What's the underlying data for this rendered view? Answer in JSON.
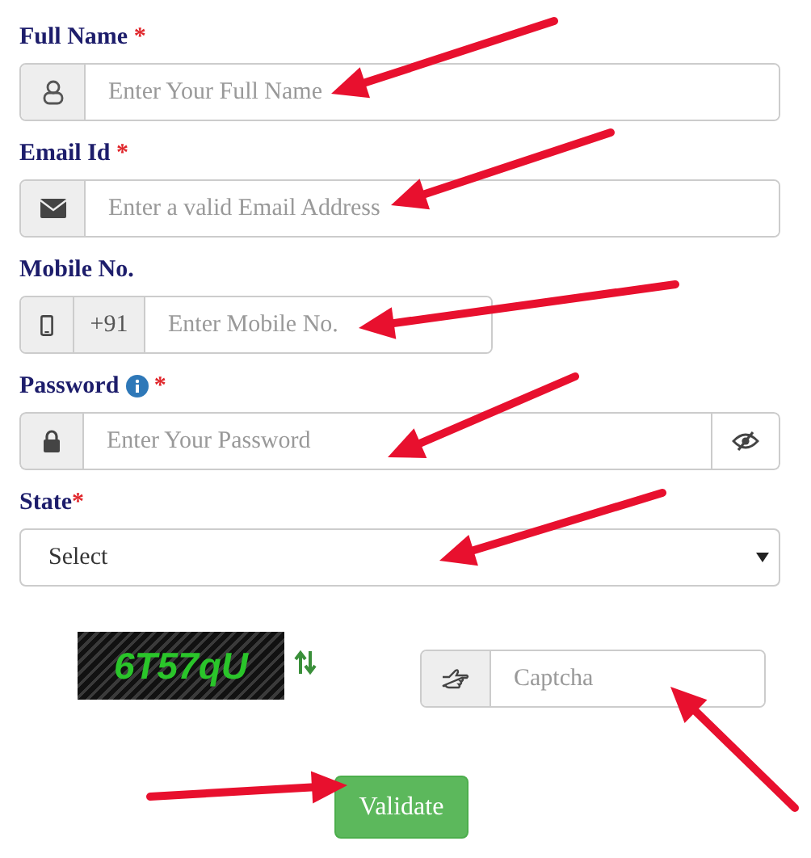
{
  "fields": [
    {
      "kind": "text",
      "label": "Full Name",
      "required_mark": " *",
      "placeholder": "Enter Your Full Name"
    },
    {
      "kind": "email",
      "label": "Email Id",
      "required_mark": " *",
      "placeholder": "Enter a valid Email Address"
    },
    {
      "kind": "phone",
      "label": "Mobile No.",
      "prefix": "+91",
      "placeholder": "Enter Mobile No."
    },
    {
      "kind": "password",
      "label": "Password",
      "info": true,
      "required_mark": " *",
      "placeholder": "Enter Your Password"
    },
    {
      "kind": "select",
      "label": "State",
      "required_mark": "*",
      "value": "Select"
    }
  ],
  "captcha": {
    "code": "6T57qU",
    "placeholder": "Captcha"
  },
  "submit": "Validate"
}
